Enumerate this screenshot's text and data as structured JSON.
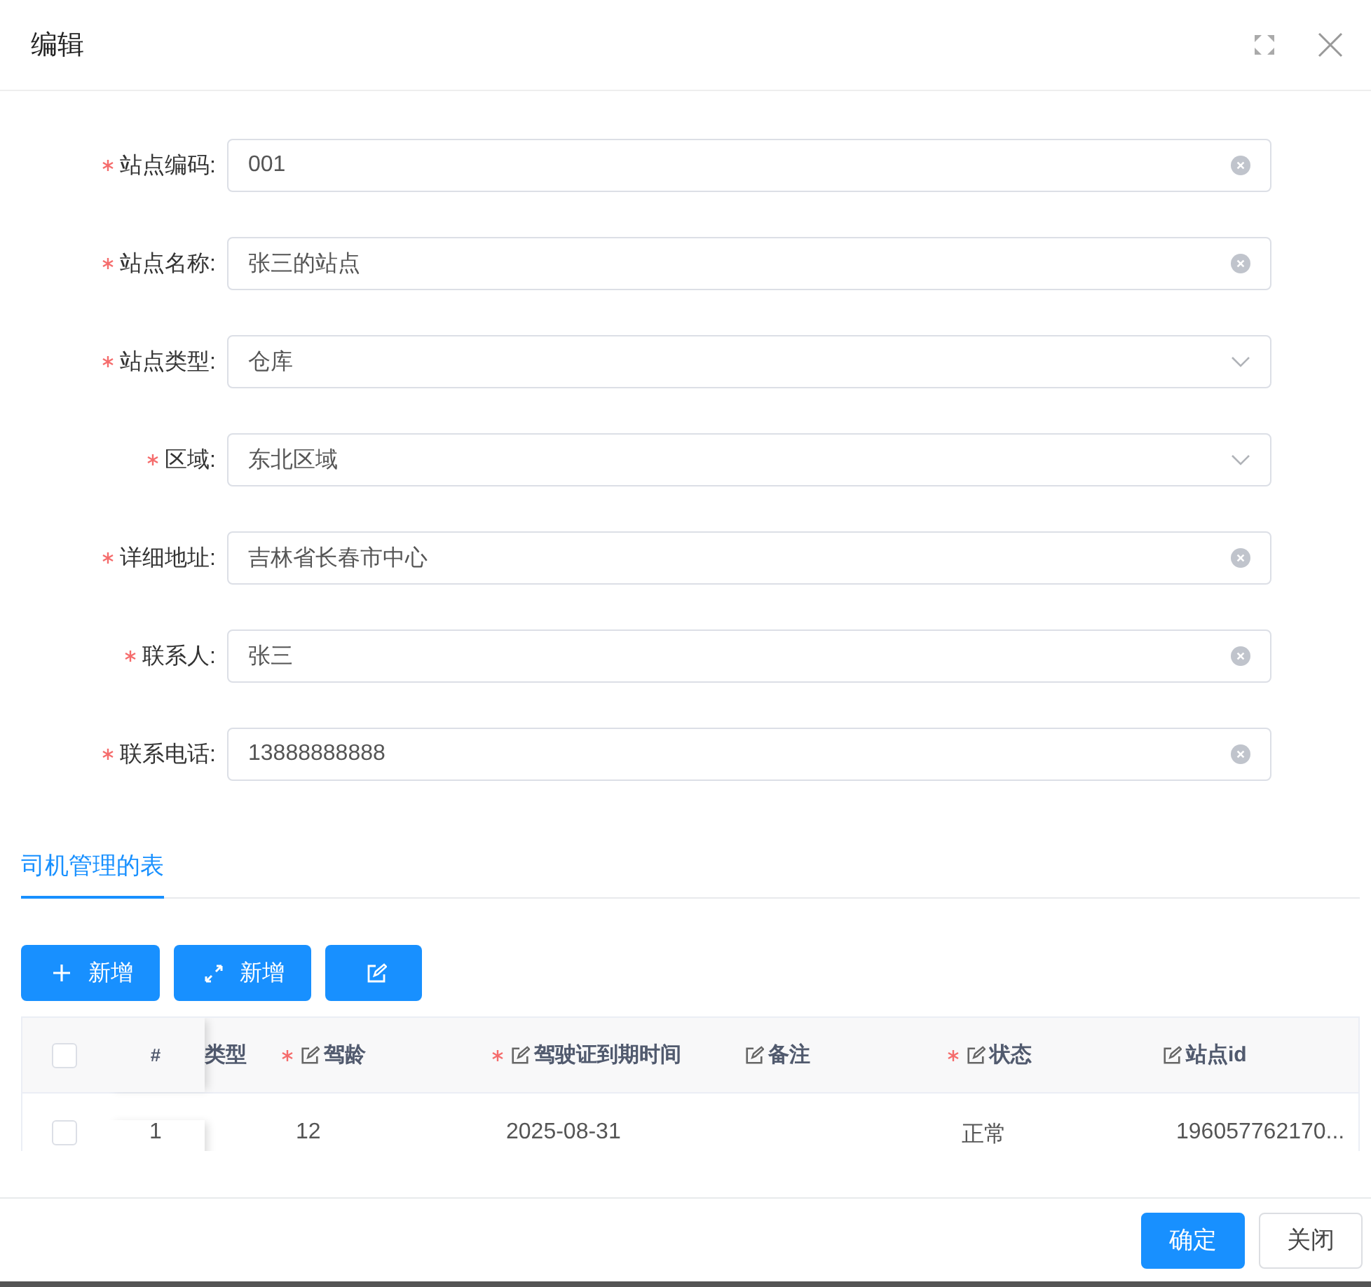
{
  "window": {
    "title": "编辑"
  },
  "form": [
    {
      "label": "站点编码:",
      "required": true,
      "kind": "input",
      "value": "001"
    },
    {
      "label": "站点名称:",
      "required": true,
      "kind": "input",
      "value": "张三的站点"
    },
    {
      "label": "站点类型:",
      "required": true,
      "kind": "select",
      "value": "仓库"
    },
    {
      "label": "区域:",
      "required": true,
      "kind": "select",
      "value": "东北区域"
    },
    {
      "label": "详细地址:",
      "required": true,
      "kind": "input",
      "value": "吉林省长春市中心"
    },
    {
      "label": "联系人:",
      "required": true,
      "kind": "input",
      "value": "张三"
    },
    {
      "label": "联系电话:",
      "required": true,
      "kind": "input",
      "value": "13888888888"
    }
  ],
  "tabs": [
    {
      "label": "司机管理的表",
      "selected": true
    }
  ],
  "toolbar": [
    {
      "kind": "add",
      "label": "新增"
    },
    {
      "kind": "fullscreen",
      "label": "新增"
    },
    {
      "kind": "edit"
    }
  ],
  "table": {
    "all_checked": false,
    "index_heading": "#",
    "columns": [
      {
        "label": "类型",
        "required": false,
        "editable": false
      },
      {
        "label": "驾龄",
        "required": true,
        "editable": true
      },
      {
        "label": "驾驶证到期时间",
        "required": true,
        "editable": true
      },
      {
        "label": "备注",
        "required": false,
        "editable": true
      },
      {
        "label": "状态",
        "required": true,
        "editable": true
      },
      {
        "label": "站点id",
        "required": false,
        "editable": true
      }
    ],
    "rows": [
      {
        "checked": false,
        "index": "1",
        "cells": [
          null,
          "12",
          "2025-08-31",
          null,
          "正常",
          "196057762170..."
        ]
      }
    ]
  },
  "footer_buttons": [
    {
      "label": "确定",
      "primary": true
    },
    {
      "label": "关闭",
      "primary": false
    }
  ]
}
